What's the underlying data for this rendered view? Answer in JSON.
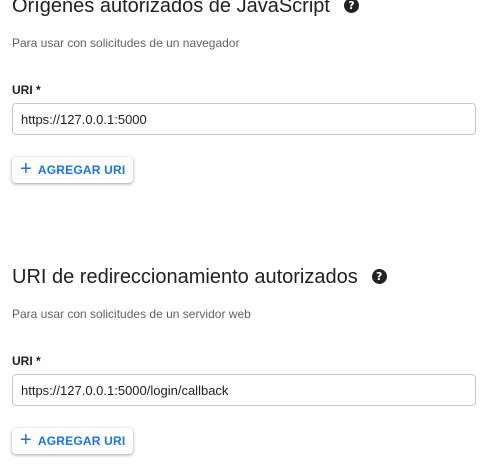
{
  "js_origins": {
    "title": "Orígenes autorizados de JavaScript",
    "subtitle": "Para usar con solicitudes de un navegador",
    "field_label": "URI *",
    "uri_value": "https://127.0.0.1:5000",
    "add_button_label": "AGREGAR URI",
    "help_icon": "help-circle-icon"
  },
  "redirect_uris": {
    "title": "URI de redireccionamiento autorizados",
    "subtitle": "Para usar con solicitudes de un servidor web",
    "field_label": "URI *",
    "uri_value": "https://127.0.0.1:5000/login/callback",
    "add_button_label": "AGREGAR URI",
    "help_icon": "help-circle-icon"
  },
  "colors": {
    "accent": "#1a73e8",
    "text": "#202124",
    "secondary_text": "#5f6368",
    "border": "#c4c7c5"
  }
}
